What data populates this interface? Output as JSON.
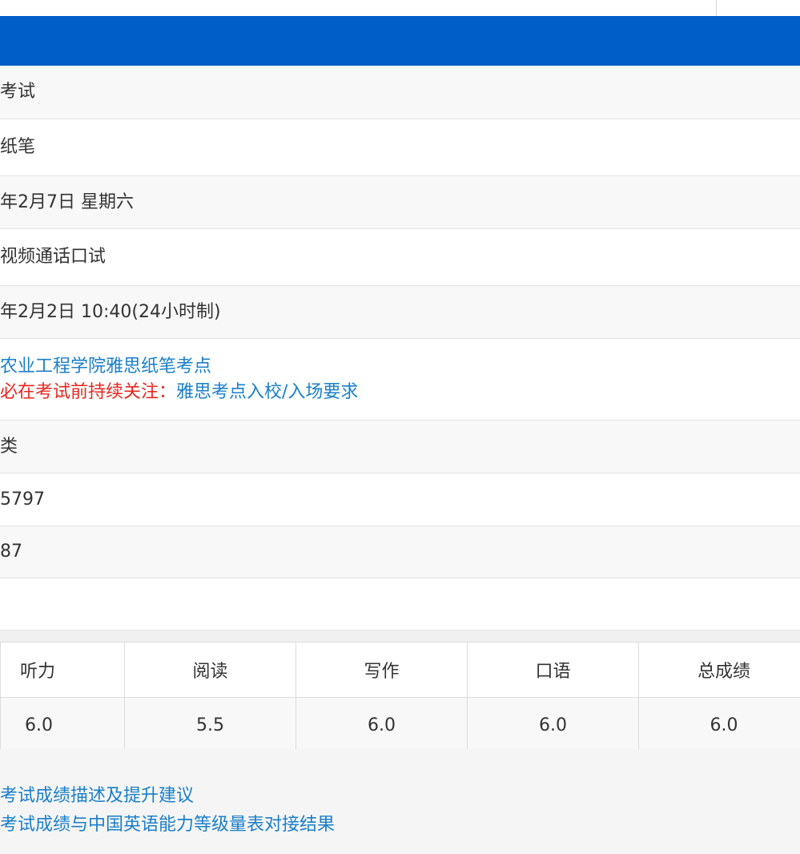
{
  "info_rows": [
    {
      "text": "考试"
    },
    {
      "text": "纸笔"
    },
    {
      "text": "年2月7日 星期六"
    },
    {
      "text": "视频通话口试"
    },
    {
      "text": "年2月2日 10:40(24小时制)"
    },
    {
      "venue_link": "农业工程学院雅思纸笔考点",
      "notice_prefix": "必在考试前持续关注：",
      "notice_link": "雅思考点入校/入场要求"
    },
    {
      "text": "类"
    },
    {
      "text": "5797"
    },
    {
      "text": "87"
    },
    {
      "text": ""
    }
  ],
  "scores": {
    "headers": [
      "听力",
      "阅读",
      "写作",
      "口语",
      "总成绩"
    ],
    "values": [
      "6.0",
      "5.5",
      "6.0",
      "6.0",
      "6.0"
    ]
  },
  "footer_links": [
    "考试成绩描述及提升建议",
    "考试成绩与中国英语能力等级量表对接结果"
  ],
  "colors": {
    "header_band": "#005ec8",
    "link": "#1a7fc9",
    "warning": "#e8261e"
  }
}
